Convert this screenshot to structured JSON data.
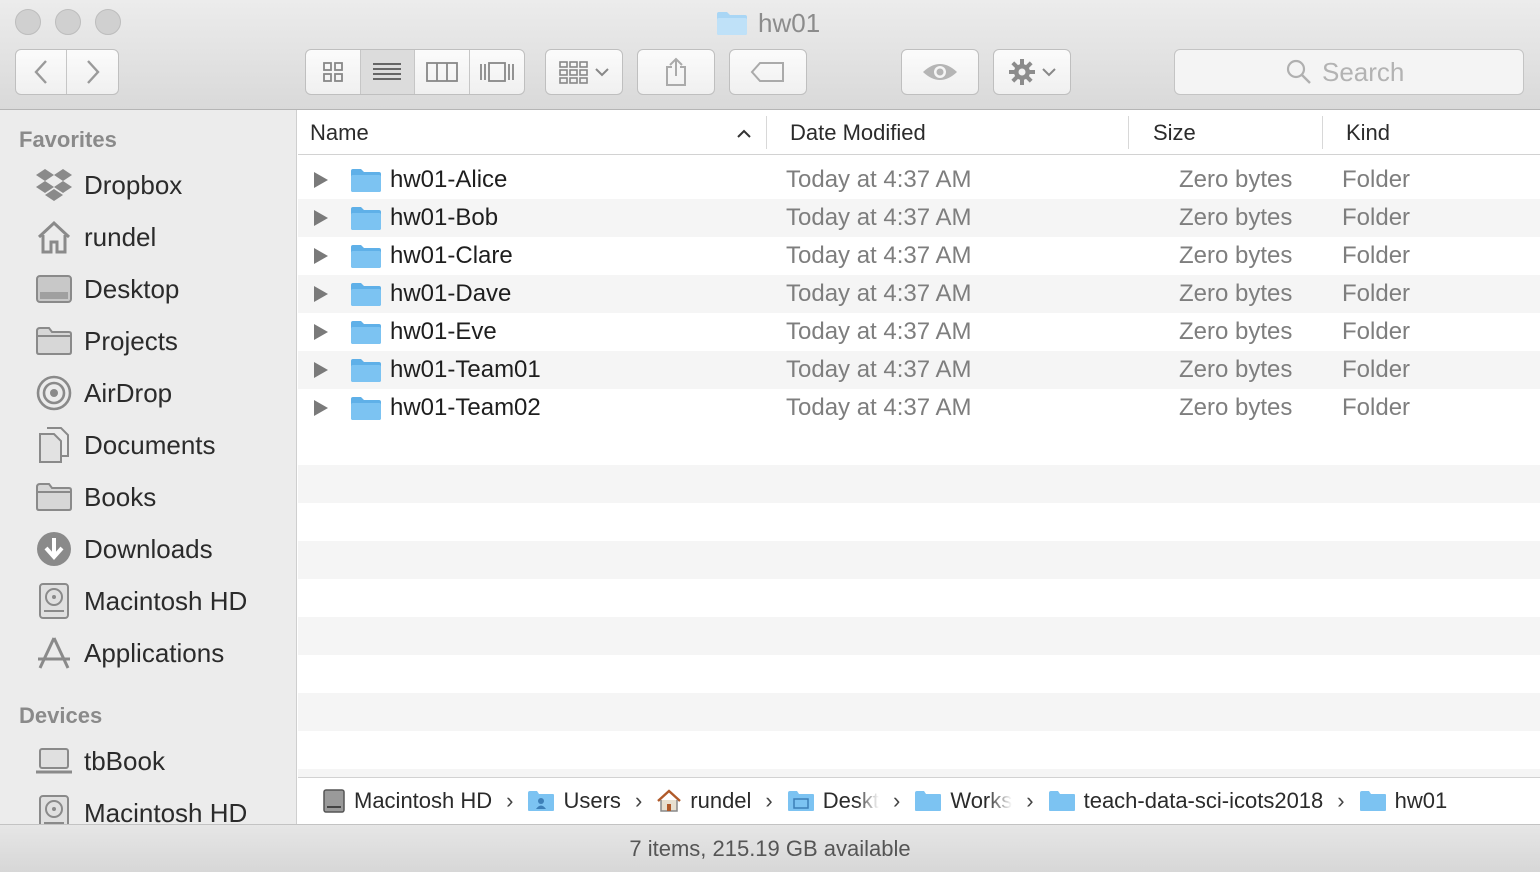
{
  "window": {
    "title": "hw01"
  },
  "toolbar": {
    "search_placeholder": "Search"
  },
  "sidebar": {
    "favorites_heading": "Favorites",
    "favorites": [
      {
        "label": "Dropbox",
        "icon": "dropbox-icon"
      },
      {
        "label": "rundel",
        "icon": "home-icon"
      },
      {
        "label": "Desktop",
        "icon": "desktop-icon"
      },
      {
        "label": "Projects",
        "icon": "folder-icon"
      },
      {
        "label": "AirDrop",
        "icon": "airdrop-icon"
      },
      {
        "label": "Documents",
        "icon": "documents-icon"
      },
      {
        "label": "Books",
        "icon": "folder-icon"
      },
      {
        "label": "Downloads",
        "icon": "downloads-icon"
      },
      {
        "label": "Macintosh HD",
        "icon": "hard-drive-icon"
      },
      {
        "label": "Applications",
        "icon": "applications-icon"
      }
    ],
    "devices_heading": "Devices",
    "devices": [
      {
        "label": "tbBook",
        "icon": "laptop-icon"
      },
      {
        "label": "Macintosh HD",
        "icon": "hard-drive-icon"
      }
    ]
  },
  "columns": {
    "name": "Name",
    "date_modified": "Date Modified",
    "size": "Size",
    "kind": "Kind"
  },
  "files": [
    {
      "name": "hw01-Alice",
      "date": "Today at 4:37 AM",
      "size": "Zero bytes",
      "kind": "Folder"
    },
    {
      "name": "hw01-Bob",
      "date": "Today at 4:37 AM",
      "size": "Zero bytes",
      "kind": "Folder"
    },
    {
      "name": "hw01-Clare",
      "date": "Today at 4:37 AM",
      "size": "Zero bytes",
      "kind": "Folder"
    },
    {
      "name": "hw01-Dave",
      "date": "Today at 4:37 AM",
      "size": "Zero bytes",
      "kind": "Folder"
    },
    {
      "name": "hw01-Eve",
      "date": "Today at 4:37 AM",
      "size": "Zero bytes",
      "kind": "Folder"
    },
    {
      "name": "hw01-Team01",
      "date": "Today at 4:37 AM",
      "size": "Zero bytes",
      "kind": "Folder"
    },
    {
      "name": "hw01-Team02",
      "date": "Today at 4:37 AM",
      "size": "Zero bytes",
      "kind": "Folder"
    }
  ],
  "path": [
    {
      "label": "Macintosh HD",
      "icon": "hard-drive-icon"
    },
    {
      "label": "Users",
      "icon": "users-folder-icon"
    },
    {
      "label": "rundel",
      "icon": "home-icon"
    },
    {
      "label": "Deskt",
      "icon": "desktop-folder-icon"
    },
    {
      "label": "Works",
      "icon": "folder-icon"
    },
    {
      "label": "teach-data-sci-icots2018",
      "icon": "folder-icon"
    },
    {
      "label": "hw01",
      "icon": "folder-icon"
    }
  ],
  "status": {
    "text": "7 items, 215.19 GB available"
  },
  "colors": {
    "folder": "#7cc3f2",
    "folder_dark": "#5fb0e8",
    "selection_stripe": "#f5f5f5"
  }
}
